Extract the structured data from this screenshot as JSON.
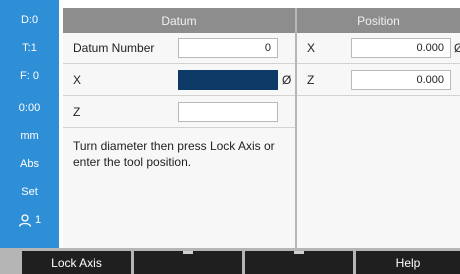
{
  "sidebar": {
    "items": [
      {
        "label": "D:0"
      },
      {
        "label": "T:1"
      },
      {
        "label": "F:  0"
      },
      {
        "label": "0:00"
      },
      {
        "label": "mm"
      },
      {
        "label": "Abs"
      },
      {
        "label": "Set"
      },
      {
        "label": "1",
        "icon": "user-icon"
      }
    ]
  },
  "datum": {
    "header": "Datum",
    "rows": [
      {
        "label": "Datum Number",
        "value": "0"
      },
      {
        "label": "X",
        "value": "",
        "suffix": "Ø"
      },
      {
        "label": "Z",
        "value": ""
      }
    ],
    "message": "Turn diameter then press Lock Axis or enter the tool position."
  },
  "position": {
    "header": "Position",
    "rows": [
      {
        "label": "X",
        "value": "0.000",
        "suffix": "Ø"
      },
      {
        "label": "Z",
        "value": "0.000"
      }
    ]
  },
  "softkeys": [
    {
      "label": "Lock Axis"
    },
    {
      "label": ""
    },
    {
      "label": ""
    },
    {
      "label": "Help"
    }
  ],
  "colors": {
    "sidebar": "#2f8fd6",
    "header": "#8d8d8d",
    "active_field": "#0d3a66",
    "softkey": "#1f1f1f"
  }
}
